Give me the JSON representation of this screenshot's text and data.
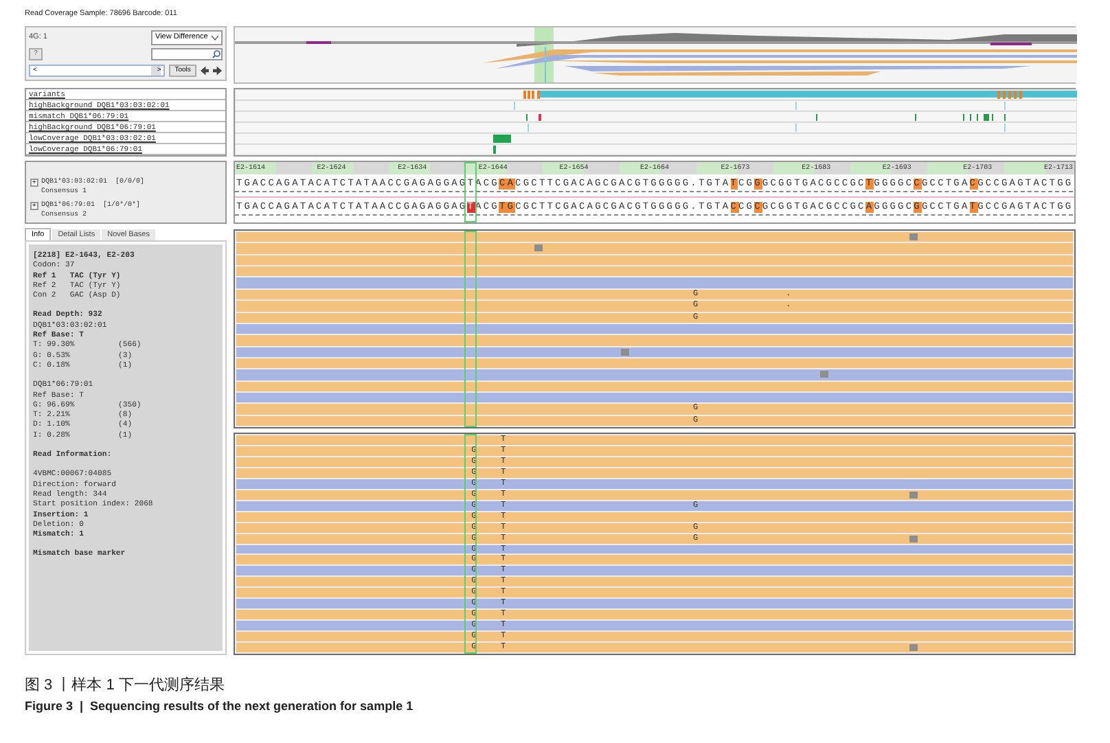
{
  "title": "Read Coverage Sample: 78696 Barcode: 011",
  "controls": {
    "group_label": "4G: 1",
    "view_select": "View Difference",
    "help_button": "?",
    "scroll_left": "<",
    "scroll_right": ">",
    "tools_button": "Tools"
  },
  "track_labels": [
    "variants",
    "highBackground DQB1*03:03:02:01",
    "mismatch DQB1*06:79:01",
    "highBackground DQB1*06:79:01",
    "lowCoverage DQB1*03:03:02:01",
    "lowCoverage DQB1*06:79:01"
  ],
  "positions": [
    "E2-1614",
    "E2-1624",
    "E2-1634",
    "E2-1644",
    "E2-1654",
    "E2-1664",
    "E2-1673",
    "E2-1683",
    "E2-1693",
    "E2-1703",
    "E2-1713"
  ],
  "consensus": [
    {
      "expand": "+",
      "allele": "DQB1*03:03:02:01  [0/0/0]",
      "name": "Consensus 1",
      "segments": [
        {
          "text": "TGACCAGATACATCTATAACCGAGAGGAGTACG",
          "kind": "plain"
        },
        {
          "text": "CA",
          "kind": "diff"
        },
        {
          "text": "CGCTTCGACAGCGACGTGGGGG.TGTA",
          "kind": "plain"
        },
        {
          "text": "T",
          "kind": "diff"
        },
        {
          "text": "CG",
          "kind": "plain"
        },
        {
          "text": "G",
          "kind": "diff"
        },
        {
          "text": "GCGGTGACGCCGC",
          "kind": "plain"
        },
        {
          "text": "T",
          "kind": "diff"
        },
        {
          "text": "GGGGC",
          "kind": "plain"
        },
        {
          "text": "C",
          "kind": "diff"
        },
        {
          "text": "GCCTGA",
          "kind": "plain"
        },
        {
          "text": "C",
          "kind": "diff"
        },
        {
          "text": "GCCGAGTACTGG",
          "kind": "plain"
        }
      ]
    },
    {
      "expand": "+",
      "allele": "DQB1*06:79:01  [1/0*/0*]",
      "name": "Consensus 2",
      "segments": [
        {
          "text": "TGACCAGATACATCTATAACCGAGAGGAG",
          "kind": "plain"
        },
        {
          "text": "T",
          "kind": "mismatch"
        },
        {
          "text": "ACG",
          "kind": "plain"
        },
        {
          "text": "TG",
          "kind": "diff"
        },
        {
          "text": "CGCTTCGACAGCGACGTGGGGG.TGTA",
          "kind": "plain"
        },
        {
          "text": "C",
          "kind": "diff"
        },
        {
          "text": "CG",
          "kind": "plain"
        },
        {
          "text": "C",
          "kind": "diff"
        },
        {
          "text": "GCGGTGACGCCGC",
          "kind": "plain"
        },
        {
          "text": "A",
          "kind": "diff"
        },
        {
          "text": "GGGGC",
          "kind": "plain"
        },
        {
          "text": "G",
          "kind": "diff"
        },
        {
          "text": "GCCTGA",
          "kind": "plain"
        },
        {
          "text": "T",
          "kind": "diff"
        },
        {
          "text": "GCCGAGTACTGG",
          "kind": "plain"
        }
      ]
    }
  ],
  "tabs": [
    {
      "label": "Info",
      "selected": true
    },
    {
      "label": "Detail Lists",
      "selected": false
    },
    {
      "label": "Novel Bases",
      "selected": false
    }
  ],
  "info_blocks": [
    {
      "lines": [
        {
          "text": "[2218] E2-1643, E2-203",
          "bold": true
        },
        {
          "text": "Codon: 37",
          "bold": false
        },
        {
          "text": "Ref 1   TAC (Tyr Y)",
          "bold": true
        },
        {
          "text": "Ref 2   TAC (Tyr Y)",
          "bold": false
        },
        {
          "text": "Con 2   GAC (Asp D)",
          "bold": false
        }
      ]
    },
    {
      "lines": [
        {
          "text": "Read Depth: 932",
          "bold": true
        },
        {
          "text": "DQB1*03:03:02:01",
          "bold": false
        },
        {
          "text": "Ref Base: T",
          "bold": true
        },
        {
          "text": "T: 99.30%",
          "count": "(566)",
          "bold": false
        },
        {
          "text": "G: 0.53%",
          "count": "(3)",
          "bold": false
        },
        {
          "text": "C: 0.18%",
          "count": "(1)",
          "bold": false
        }
      ]
    },
    {
      "lines": [
        {
          "text": "DQB1*06:79:01",
          "bold": false
        },
        {
          "text": "Ref Base: T",
          "bold": false
        },
        {
          "text": "G: 96.69%",
          "count": "(350)",
          "bold": false
        },
        {
          "text": "T: 2.21%",
          "count": "(8)",
          "bold": false
        },
        {
          "text": "D: 1.10%",
          "count": "(4)",
          "bold": false
        },
        {
          "text": "I: 0.28%",
          "count": "(1)",
          "bold": false
        }
      ]
    },
    {
      "lines": [
        {
          "text": "Read Information:",
          "bold": true
        }
      ]
    },
    {
      "lines": [
        {
          "text": "4VBMC:00067:04085",
          "bold": false
        },
        {
          "text": "Direction: forward",
          "bold": false
        },
        {
          "text": "Read length: 344",
          "bold": false
        },
        {
          "text": "Start position index: 2068",
          "bold": false
        },
        {
          "text": "Insertion: 1",
          "bold": true
        },
        {
          "text": "Deletion: 0",
          "bold": false
        },
        {
          "text": "Mismatch: 1",
          "bold": true
        }
      ]
    },
    {
      "lines": [
        {
          "text": "Mismatch base marker",
          "bold": true
        }
      ]
    }
  ],
  "read_groups": [
    {
      "rows": [
        {
          "kind": "forward",
          "items": [
            {
              "kind": "marker8"
            }
          ]
        },
        {
          "kind": "forward",
          "items": [
            {
              "kind": "marker5"
            }
          ]
        },
        {
          "kind": "forward",
          "items": []
        },
        {
          "kind": "forward",
          "items": []
        },
        {
          "kind": "reverse",
          "items": []
        },
        {
          "kind": "forward",
          "items": [
            {
              "kind": "base3",
              "text": "G"
            },
            {
              "kind": "base4",
              "text": "."
            }
          ]
        },
        {
          "kind": "forward",
          "items": [
            {
              "kind": "base3",
              "text": "G"
            },
            {
              "kind": "base4",
              "text": "."
            }
          ]
        },
        {
          "kind": "forward",
          "items": [
            {
              "kind": "base3",
              "text": "G"
            }
          ]
        },
        {
          "kind": "reverse",
          "items": []
        },
        {
          "kind": "forward",
          "items": []
        },
        {
          "kind": "reverse",
          "items": [
            {
              "kind": "marker6"
            }
          ]
        },
        {
          "kind": "forward",
          "items": []
        },
        {
          "kind": "reverse",
          "items": [
            {
              "kind": "marker7"
            }
          ]
        },
        {
          "kind": "forward",
          "items": []
        },
        {
          "kind": "reverse",
          "items": []
        },
        {
          "kind": "forward",
          "items": [
            {
              "kind": "base3",
              "text": "G"
            }
          ]
        },
        {
          "kind": "forward",
          "items": [
            {
              "kind": "base3",
              "text": "G"
            }
          ]
        }
      ]
    },
    {
      "rows": [
        {
          "kind": "forward",
          "items": [
            {
              "kind": "base2",
              "text": "T"
            }
          ]
        },
        {
          "kind": "forward",
          "items": [
            {
              "kind": "base1",
              "text": "G"
            },
            {
              "kind": "base2",
              "text": "T"
            }
          ]
        },
        {
          "kind": "forward",
          "items": [
            {
              "kind": "base1",
              "text": "G"
            },
            {
              "kind": "base2",
              "text": "T"
            }
          ]
        },
        {
          "kind": "forward",
          "items": [
            {
              "kind": "base1",
              "text": "G"
            },
            {
              "kind": "base2",
              "text": "T"
            }
          ]
        },
        {
          "kind": "reverse",
          "items": [
            {
              "kind": "base1",
              "text": "G"
            },
            {
              "kind": "base2",
              "text": "T"
            }
          ]
        },
        {
          "kind": "forward",
          "items": [
            {
              "kind": "base1",
              "text": "G"
            },
            {
              "kind": "base2",
              "text": "T"
            },
            {
              "kind": "marker8"
            }
          ]
        },
        {
          "kind": "reverse",
          "items": [
            {
              "kind": "base1",
              "text": "G"
            },
            {
              "kind": "base2",
              "text": "T"
            },
            {
              "kind": "base3",
              "text": "G"
            }
          ]
        },
        {
          "kind": "forward",
          "items": [
            {
              "kind": "base1",
              "text": "G"
            },
            {
              "kind": "base2",
              "text": "T"
            }
          ]
        },
        {
          "kind": "forward",
          "items": [
            {
              "kind": "base1",
              "text": "G"
            },
            {
              "kind": "base2",
              "text": "T"
            },
            {
              "kind": "base3",
              "text": "G"
            }
          ]
        },
        {
          "kind": "forward",
          "items": [
            {
              "kind": "base1",
              "text": "G"
            },
            {
              "kind": "base2",
              "text": "T"
            },
            {
              "kind": "base3",
              "text": "G"
            },
            {
              "kind": "marker8"
            }
          ]
        },
        {
          "kind": "reverse",
          "items": [
            {
              "kind": "base1",
              "text": "G"
            },
            {
              "kind": "base2",
              "text": "T"
            }
          ]
        },
        {
          "kind": "forward",
          "items": [
            {
              "kind": "base1",
              "text": "G"
            },
            {
              "kind": "base2",
              "text": "T"
            }
          ]
        },
        {
          "kind": "reverse",
          "items": [
            {
              "kind": "base1",
              "text": "G"
            },
            {
              "kind": "base2",
              "text": "T"
            }
          ]
        },
        {
          "kind": "forward",
          "items": [
            {
              "kind": "base1",
              "text": "G"
            },
            {
              "kind": "base2",
              "text": "T"
            }
          ]
        },
        {
          "kind": "forward",
          "items": [
            {
              "kind": "base1",
              "text": "G"
            },
            {
              "kind": "base2",
              "text": "T"
            }
          ]
        },
        {
          "kind": "reverse",
          "items": [
            {
              "kind": "base1",
              "text": "G"
            },
            {
              "kind": "base2",
              "text": "T"
            }
          ]
        },
        {
          "kind": "forward",
          "items": [
            {
              "kind": "base1",
              "text": "G"
            },
            {
              "kind": "base2",
              "text": "T"
            }
          ]
        },
        {
          "kind": "reverse",
          "items": [
            {
              "kind": "base1",
              "text": "G"
            },
            {
              "kind": "base2",
              "text": "T"
            }
          ]
        },
        {
          "kind": "forward",
          "items": [
            {
              "kind": "base1",
              "text": "G"
            },
            {
              "kind": "base2",
              "text": "T"
            }
          ]
        },
        {
          "kind": "forward",
          "items": [
            {
              "kind": "base1",
              "text": "G"
            },
            {
              "kind": "base2",
              "text": "T"
            },
            {
              "kind": "marker8"
            }
          ]
        }
      ]
    }
  ],
  "caption": {
    "chinese": "图 3 丨样本 1 下一代测序结果",
    "english": "Figure 3  |  Sequencing results of the next generation for sample 1"
  }
}
